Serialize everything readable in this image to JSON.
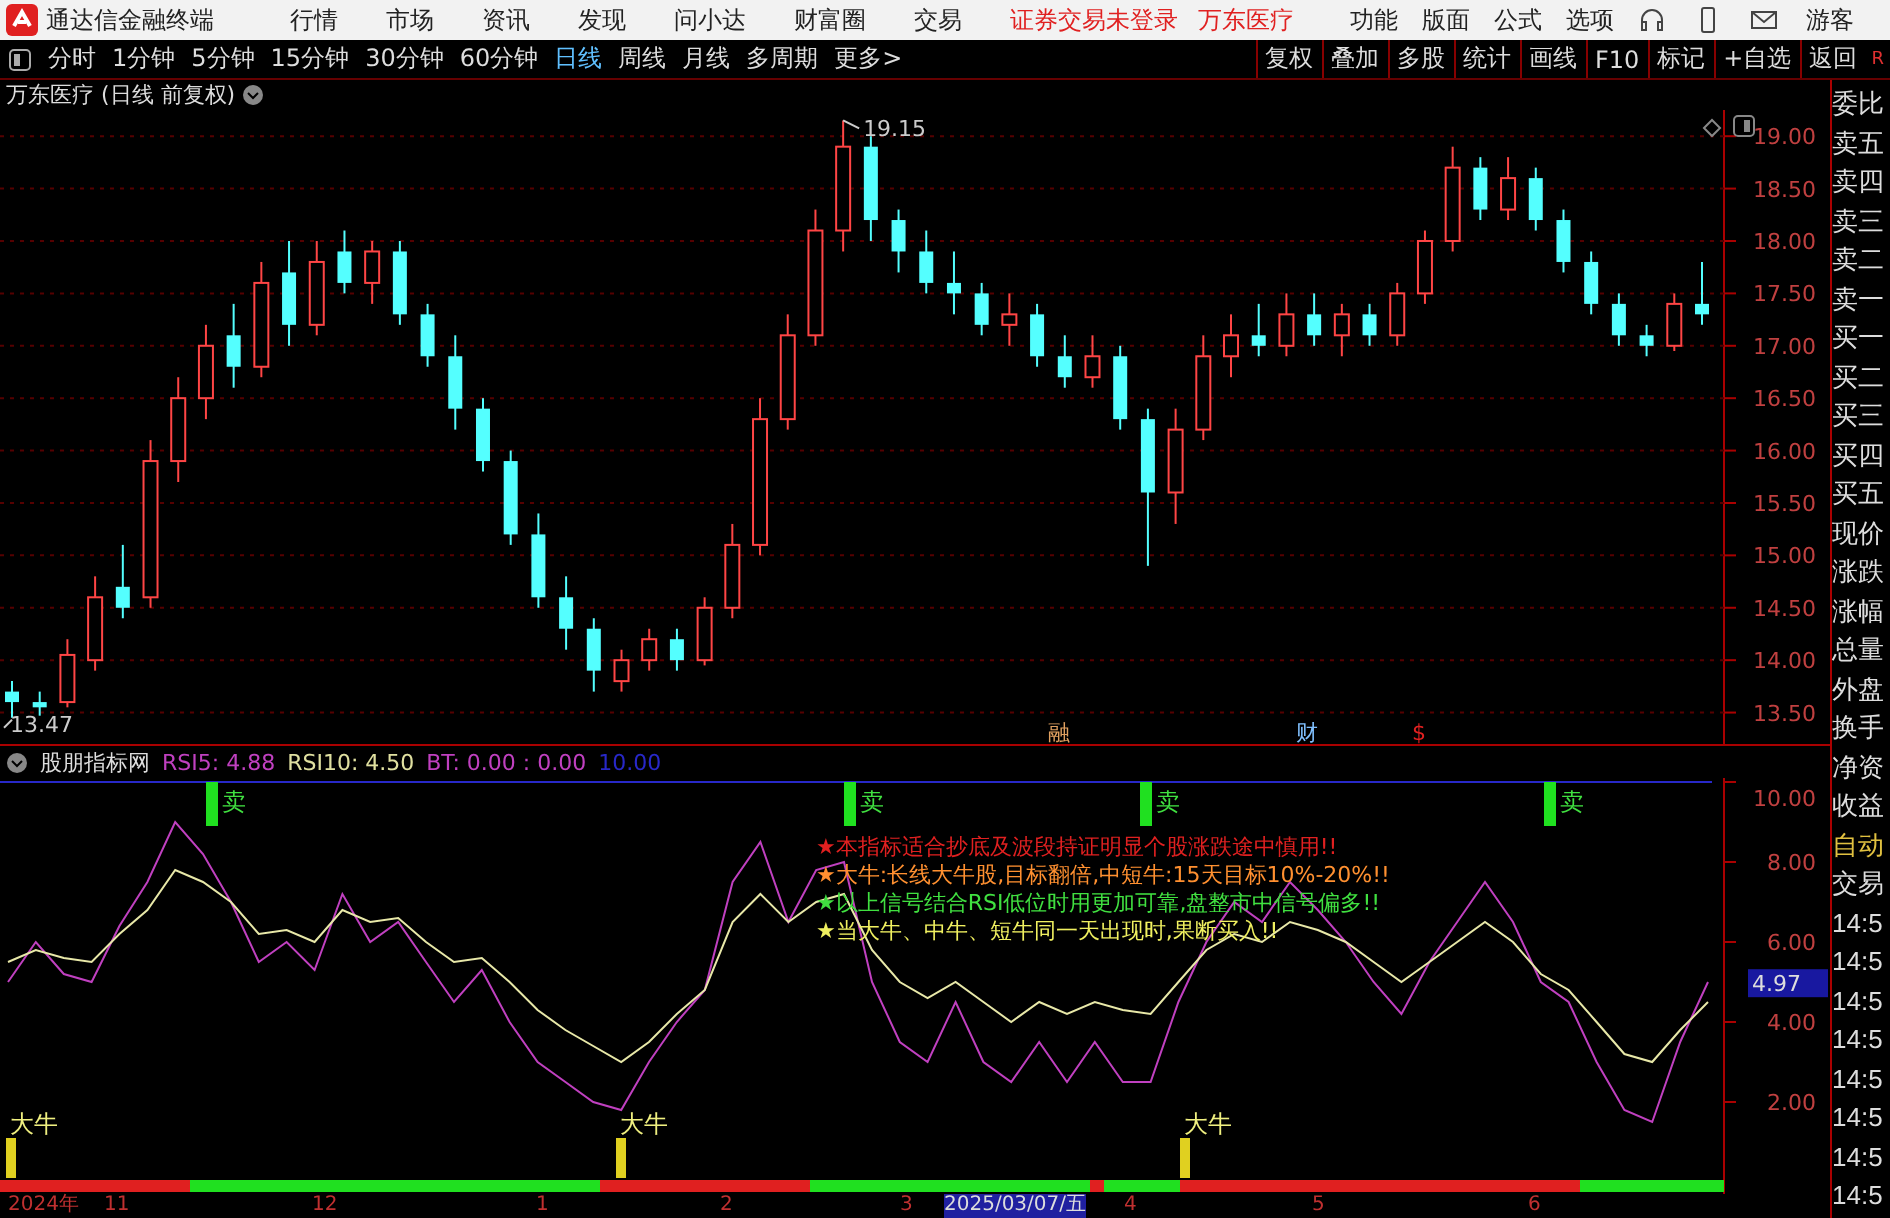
{
  "app": {
    "title": "通达信金融终端",
    "menu": [
      "行情",
      "市场",
      "资讯",
      "发现",
      "问小达",
      "财富圈",
      "交易"
    ],
    "status": [
      "证券交易未登录",
      "万东医疗"
    ],
    "right_menu": [
      "功能",
      "版面",
      "公式",
      "选项"
    ],
    "user": "游客"
  },
  "periods": [
    {
      "label": "分时",
      "selected": false
    },
    {
      "label": "1分钟",
      "selected": false
    },
    {
      "label": "5分钟",
      "selected": false
    },
    {
      "label": "15分钟",
      "selected": false
    },
    {
      "label": "30分钟",
      "selected": false
    },
    {
      "label": "60分钟",
      "selected": false
    },
    {
      "label": "日线",
      "selected": true
    },
    {
      "label": "周线",
      "selected": false
    },
    {
      "label": "月线",
      "selected": false
    },
    {
      "label": "多周期",
      "selected": false
    },
    {
      "label": "更多>",
      "selected": false
    }
  ],
  "tools": [
    "复权",
    "叠加",
    "多股",
    "统计",
    "画线",
    "F10",
    "标记",
    "+自选",
    "返回"
  ],
  "corner": "R",
  "chart": {
    "title": "万东医疗 (日线 前复权)",
    "high_label": "19.15",
    "low_label": "13.47",
    "markers": [
      "融",
      "财",
      "$"
    ],
    "chart_data": {
      "type": "candlestick",
      "grid": true,
      "ylim": [
        13.2,
        19.25
      ],
      "yticks": [
        {
          "value": 19,
          "label": "19.00"
        },
        {
          "value": 18.5,
          "label": "18.50"
        },
        {
          "value": 18,
          "label": "18.00"
        },
        {
          "value": 17.5,
          "label": "17.50"
        },
        {
          "value": 17,
          "label": "17.00"
        },
        {
          "value": 16.5,
          "label": "16.50"
        },
        {
          "value": 16,
          "label": "16.00"
        },
        {
          "value": 15.5,
          "label": "15.50"
        },
        {
          "value": 15,
          "label": "15.00"
        },
        {
          "value": 14.5,
          "label": "14.50"
        },
        {
          "value": 14,
          "label": "14.00"
        },
        {
          "value": 13.5,
          "label": "13.50"
        }
      ],
      "ohlc": [
        [
          13.7,
          13.8,
          13.45,
          13.6
        ],
        [
          13.6,
          13.7,
          13.47,
          13.55
        ],
        [
          13.6,
          14.2,
          13.55,
          14.05
        ],
        [
          14.0,
          14.8,
          13.9,
          14.6
        ],
        [
          14.7,
          15.1,
          14.4,
          14.5
        ],
        [
          14.6,
          16.1,
          14.5,
          15.9
        ],
        [
          15.9,
          16.7,
          15.7,
          16.5
        ],
        [
          16.5,
          17.2,
          16.3,
          17.0
        ],
        [
          17.1,
          17.4,
          16.6,
          16.8
        ],
        [
          16.8,
          17.8,
          16.7,
          17.6
        ],
        [
          17.7,
          18.0,
          17.0,
          17.2
        ],
        [
          17.2,
          18.0,
          17.1,
          17.8
        ],
        [
          17.9,
          18.1,
          17.5,
          17.6
        ],
        [
          17.6,
          18.0,
          17.4,
          17.9
        ],
        [
          17.9,
          18.0,
          17.2,
          17.3
        ],
        [
          17.3,
          17.4,
          16.8,
          16.9
        ],
        [
          16.9,
          17.1,
          16.2,
          16.4
        ],
        [
          16.4,
          16.5,
          15.8,
          15.9
        ],
        [
          15.9,
          16.0,
          15.1,
          15.2
        ],
        [
          15.2,
          15.4,
          14.5,
          14.6
        ],
        [
          14.6,
          14.8,
          14.1,
          14.3
        ],
        [
          14.3,
          14.4,
          13.7,
          13.9
        ],
        [
          13.8,
          14.1,
          13.7,
          14.0
        ],
        [
          14.0,
          14.3,
          13.9,
          14.2
        ],
        [
          14.2,
          14.3,
          13.9,
          14.0
        ],
        [
          14.0,
          14.6,
          13.95,
          14.5
        ],
        [
          14.5,
          15.3,
          14.4,
          15.1
        ],
        [
          15.1,
          16.5,
          15.0,
          16.3
        ],
        [
          16.3,
          17.3,
          16.2,
          17.1
        ],
        [
          17.1,
          18.3,
          17.0,
          18.1
        ],
        [
          18.1,
          19.15,
          17.9,
          18.9
        ],
        [
          18.9,
          19.0,
          18.0,
          18.2
        ],
        [
          18.2,
          18.3,
          17.7,
          17.9
        ],
        [
          17.9,
          18.1,
          17.5,
          17.6
        ],
        [
          17.6,
          17.9,
          17.3,
          17.5
        ],
        [
          17.5,
          17.6,
          17.1,
          17.2
        ],
        [
          17.2,
          17.5,
          17.0,
          17.3
        ],
        [
          17.3,
          17.4,
          16.8,
          16.9
        ],
        [
          16.9,
          17.1,
          16.6,
          16.7
        ],
        [
          16.7,
          17.1,
          16.6,
          16.9
        ],
        [
          16.9,
          17.0,
          16.2,
          16.3
        ],
        [
          16.3,
          16.4,
          14.9,
          15.6
        ],
        [
          15.6,
          16.4,
          15.3,
          16.2
        ],
        [
          16.2,
          17.1,
          16.1,
          16.9
        ],
        [
          16.9,
          17.3,
          16.7,
          17.1
        ],
        [
          17.1,
          17.4,
          16.9,
          17.0
        ],
        [
          17.0,
          17.5,
          16.9,
          17.3
        ],
        [
          17.3,
          17.5,
          17.0,
          17.1
        ],
        [
          17.1,
          17.4,
          16.9,
          17.3
        ],
        [
          17.3,
          17.4,
          17.0,
          17.1
        ],
        [
          17.1,
          17.6,
          17.0,
          17.5
        ],
        [
          17.5,
          18.1,
          17.4,
          18.0
        ],
        [
          18.0,
          18.9,
          17.9,
          18.7
        ],
        [
          18.7,
          18.8,
          18.2,
          18.3
        ],
        [
          18.3,
          18.8,
          18.2,
          18.6
        ],
        [
          18.6,
          18.7,
          18.1,
          18.2
        ],
        [
          18.2,
          18.3,
          17.7,
          17.8
        ],
        [
          17.8,
          17.9,
          17.3,
          17.4
        ],
        [
          17.4,
          17.5,
          17.0,
          17.1
        ],
        [
          17.1,
          17.2,
          16.9,
          17.0
        ],
        [
          17.0,
          17.5,
          16.95,
          17.4
        ],
        [
          17.4,
          17.8,
          17.2,
          17.3
        ]
      ]
    }
  },
  "indicator": {
    "name": "股朋指标网",
    "readings": [
      {
        "text": "RSI5: 4.88",
        "color": "#c040c0"
      },
      {
        "text": "RSI10: 4.50",
        "color": "#e0e0a0"
      },
      {
        "text": "BT: 0.00 : 0.00",
        "color": "#c040c0"
      },
      {
        "text": "10.00",
        "color": "#2828c8"
      }
    ],
    "chart_data": {
      "type": "line",
      "ylim": [
        0.1,
        10.1
      ],
      "yticks": [
        {
          "value": 10,
          "label": "10.00"
        },
        {
          "value": 8,
          "label": "8.00"
        },
        {
          "value": 6,
          "label": "6.00"
        },
        {
          "value": 4,
          "label": "4.00"
        },
        {
          "value": 2,
          "label": "2.00"
        }
      ],
      "series": [
        {
          "color": "#c040c0",
          "values": [
            5.0,
            6.0,
            5.2,
            5.0,
            6.4,
            7.5,
            9.0,
            8.2,
            7.0,
            5.5,
            6.0,
            5.3,
            7.2,
            6.0,
            6.5,
            5.5,
            4.5,
            5.3,
            4.0,
            3.0,
            2.5,
            2.0,
            1.8,
            3.0,
            4.0,
            4.8,
            7.5,
            8.5,
            6.5,
            7.8,
            8.0,
            5.0,
            3.5,
            3.0,
            4.5,
            3.0,
            2.5,
            3.5,
            2.5,
            3.5,
            2.5,
            2.5,
            4.5,
            6.0,
            7.0,
            6.5,
            7.5,
            6.8,
            6.0,
            5.0,
            4.2,
            5.5,
            6.5,
            7.5,
            6.5,
            5.0,
            4.5,
            3.0,
            1.8,
            1.5,
            3.5,
            5.0
          ]
        },
        {
          "color": "#e8e8a8",
          "values": [
            5.5,
            5.8,
            5.6,
            5.5,
            6.2,
            6.8,
            7.8,
            7.5,
            7.0,
            6.2,
            6.3,
            6.0,
            6.8,
            6.5,
            6.6,
            6.0,
            5.5,
            5.6,
            5.0,
            4.3,
            3.8,
            3.4,
            3.0,
            3.5,
            4.2,
            4.8,
            6.5,
            7.2,
            6.5,
            7.0,
            7.2,
            5.8,
            5.0,
            4.6,
            5.0,
            4.5,
            4.0,
            4.5,
            4.2,
            4.5,
            4.3,
            4.2,
            5.0,
            5.8,
            6.2,
            6.0,
            6.5,
            6.3,
            6.0,
            5.5,
            5.0,
            5.5,
            6.0,
            6.5,
            6.0,
            5.2,
            4.8,
            4.0,
            3.2,
            3.0,
            3.8,
            4.5
          ]
        }
      ]
    },
    "current": "4.97",
    "notes": [
      {
        "text": "★本指标适合抄底及波段持证明显个股涨跌途中慎用!!",
        "color": "#e02020"
      },
      {
        "text": "★大牛:长线大牛股,目标翻倍,中短牛:15天目标10%-20%!!",
        "color": "#ff9030"
      },
      {
        "text": "★以上信号结合RSI低位时用更加可靠,盘整市中信号偏多!!",
        "color": "#40e040"
      },
      {
        "text": "★当大牛、中牛、短牛同一天出现时,果断买入!!",
        "color": "#f0f060"
      }
    ],
    "sell_labels": [
      "卖",
      "卖",
      "卖",
      "卖"
    ],
    "buy_labels": [
      "大牛",
      "大牛",
      "大牛"
    ]
  },
  "time_axis": [
    {
      "label": "2024年",
      "selected": false
    },
    {
      "label": "11",
      "selected": false
    },
    {
      "label": "12",
      "selected": false
    },
    {
      "label": "1",
      "selected": false
    },
    {
      "label": "2",
      "selected": false
    },
    {
      "label": "3",
      "selected": false
    },
    {
      "label": "2025/03/07/五",
      "selected": true
    },
    {
      "label": "4",
      "selected": false
    },
    {
      "label": "5",
      "selected": false
    },
    {
      "label": "6",
      "selected": false
    }
  ],
  "quote_panel": [
    "委比",
    "卖五",
    "卖四",
    "卖三",
    "卖二",
    "卖一",
    "买一",
    "买二",
    "买三",
    "买四",
    "买五",
    "现价",
    "涨跌",
    "涨幅",
    "总量",
    "外盘",
    "换手",
    "净资",
    "收益",
    "自动",
    "交易",
    "14:5",
    "14:5",
    "14:5",
    "14:5",
    "14:5",
    "14:5",
    "14:5",
    "14:5"
  ]
}
